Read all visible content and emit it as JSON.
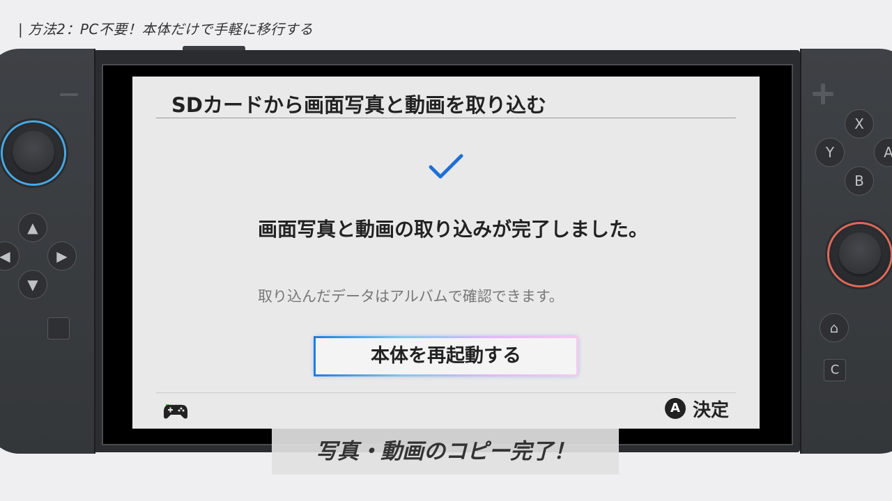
{
  "heading": "| 方法2：PC不要！本体だけで手軽に移行する",
  "screen": {
    "title": "SDカードから画面写真と動画を取り込む",
    "message": "画面写真と動画の取り込みが完了しました。",
    "sub_message": "取り込んだデータはアルバムで確認できます。",
    "restart_button": "本体を再起動する",
    "a_button": "A",
    "a_action": "決定"
  },
  "console": {
    "buttons": {
      "x": "X",
      "y": "Y",
      "a": "A",
      "b": "B",
      "capture": "",
      "home": "⌂",
      "c": "C"
    }
  },
  "caption": "写真・動画のコピー完了！",
  "colors": {
    "accent": "#1f7fe0",
    "joycon_left_ring": "#47a9e6",
    "joycon_right_ring": "#e06a5a"
  }
}
